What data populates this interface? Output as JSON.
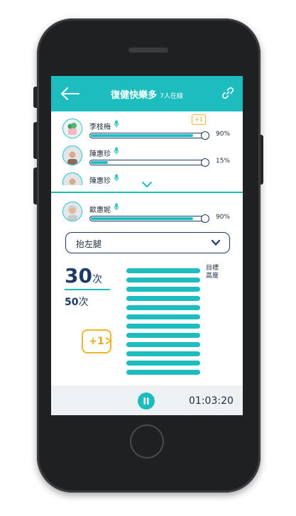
{
  "header": {
    "title": "復健快樂多",
    "online_count": "7人在線",
    "back_icon": "back-arrow-icon",
    "link_icon": "link-icon"
  },
  "participants": [
    {
      "name": "李枝梅",
      "progress_pct": 90,
      "percent_label": "90%",
      "plus_badge": "+1"
    },
    {
      "name": "陳惠珍",
      "progress_pct": 15,
      "percent_label": "15%"
    },
    {
      "name": "陳惠珍"
    }
  ],
  "current_user": {
    "name": "歐惠妮",
    "progress_pct": 90,
    "percent_label": "90%"
  },
  "exercise": {
    "selected": "抬左腿"
  },
  "counter": {
    "current": "30",
    "unit": "次",
    "target": "50",
    "target_unit": "次"
  },
  "height_chart": {
    "goal_label": "目標高度",
    "bar_count": 12
  },
  "plus_badge": "+1",
  "footer": {
    "timer": "01:03:20",
    "pause_icon": "pause-icon"
  },
  "colors": {
    "accent": "#1dbdbf",
    "navy": "#1d3a66",
    "badge": "#f0b429"
  }
}
